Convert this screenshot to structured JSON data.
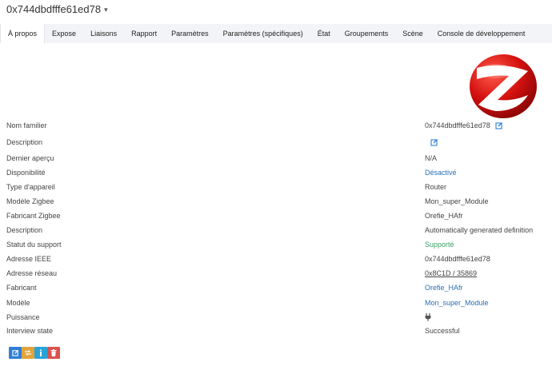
{
  "header": {
    "device_name": "0x744dbdfffe61ed78"
  },
  "tabs": [
    {
      "label": "À propos",
      "active": true
    },
    {
      "label": "Expose"
    },
    {
      "label": "Liaisons"
    },
    {
      "label": "Rapport"
    },
    {
      "label": "Paramètres"
    },
    {
      "label": "Paramètres (spécifiques)"
    },
    {
      "label": "État"
    },
    {
      "label": "Groupements"
    },
    {
      "label": "Scène"
    },
    {
      "label": "Console de développement"
    }
  ],
  "details": {
    "friendly_name": {
      "label": "Nom familier",
      "value": "0x744dbdfffe61ed78"
    },
    "description_edit": {
      "label": "Description"
    },
    "last_seen": {
      "label": "Dernier aperçu",
      "value": "N/A"
    },
    "availability": {
      "label": "Disponibilité",
      "value": "Désactivé"
    },
    "device_type": {
      "label": "Type d'appareil",
      "value": "Router"
    },
    "zigbee_model": {
      "label": "Modèle Zigbee",
      "value": "Mon_super_Module"
    },
    "zigbee_manufacturer": {
      "label": "Fabricant Zigbee",
      "value": "Orefie_HAfr"
    },
    "description": {
      "label": "Description",
      "value": "Automatically generated definition"
    },
    "support_status": {
      "label": "Statut du support",
      "value": "Supporté"
    },
    "ieee_address": {
      "label": "Adresse IEEE",
      "value": "0x744dbdfffe61ed78"
    },
    "network_address": {
      "label": "Adresse réseau",
      "value_hex": "0x8C1D",
      "value_sep": " / ",
      "value_dec": "35869"
    },
    "manufacturer": {
      "label": "Fabricant",
      "value": "Orefie_HAfr"
    },
    "model": {
      "label": "Modèle",
      "value": "Mon_super_Module"
    },
    "power": {
      "label": "Puissance",
      "icon": "plug-icon"
    },
    "interview_state": {
      "label": "Interview state",
      "value": "Successful"
    }
  },
  "colors": {
    "link": "#2a6fb3",
    "success": "#3aa064",
    "btn_edit": "#2f7fd6",
    "btn_reconfigure": "#e2a33a",
    "btn_info": "#2aa3d6",
    "btn_delete": "#d9534f",
    "logo_red": "#cc1111"
  },
  "actions": [
    {
      "name": "edit-button",
      "icon": "edit-icon"
    },
    {
      "name": "reconfigure-button",
      "icon": "refresh-icon"
    },
    {
      "name": "interview-button",
      "icon": "info-icon"
    },
    {
      "name": "delete-button",
      "icon": "trash-icon"
    }
  ]
}
